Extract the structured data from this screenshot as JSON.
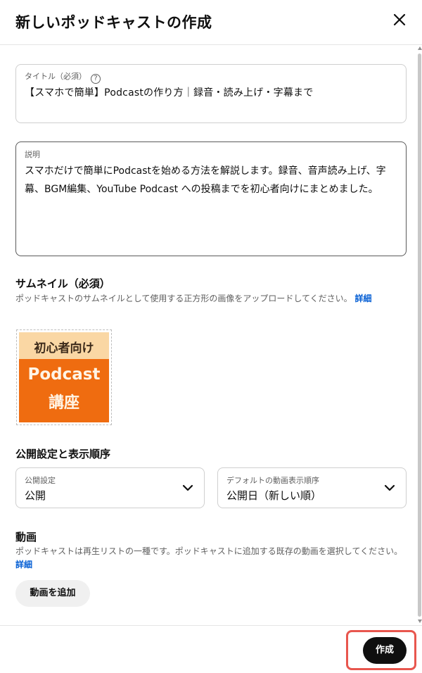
{
  "dialog": {
    "title": "新しいポッドキャストの作成",
    "close_icon": "close-icon"
  },
  "title_field": {
    "label": "タイトル（必須）",
    "help_icon": "help-circle-icon",
    "help_glyph": "?",
    "value": "【スマホで簡単】Podcastの作り方｜録音・読み上げ・字幕まで"
  },
  "description_field": {
    "label": "説明",
    "value": "スマホだけで簡単にPodcastを始める方法を解説します。録音、音声読み上げ、字幕、BGM編集、YouTube Podcast への投稿までを初心者向けにまとめました。"
  },
  "thumbnail": {
    "heading": "サムネイル（必須）",
    "description": "ポッドキャストのサムネイルとして使用する正方形の画像をアップロードしてください。",
    "link": "詳細",
    "image": {
      "top_text": "初心者向け",
      "line1": "Podcast",
      "line2": "講座",
      "top_color": "#fad7a4",
      "bottom_color": "#ef6c10"
    }
  },
  "visibility_section": {
    "heading": "公開設定と表示順序",
    "visibility": {
      "label": "公開設定",
      "value": "公開"
    },
    "order": {
      "label": "デフォルトの動画表示順序",
      "value": "公開日（新しい順）"
    }
  },
  "videos_section": {
    "heading": "動画",
    "description": "ポッドキャストは再生リストの一種です。ポッドキャストに追加する既存の動画を選択してください。",
    "link": "詳細",
    "add_button": "動画を追加"
  },
  "footer": {
    "create_button": "作成",
    "highlight_color": "#e8564e"
  }
}
